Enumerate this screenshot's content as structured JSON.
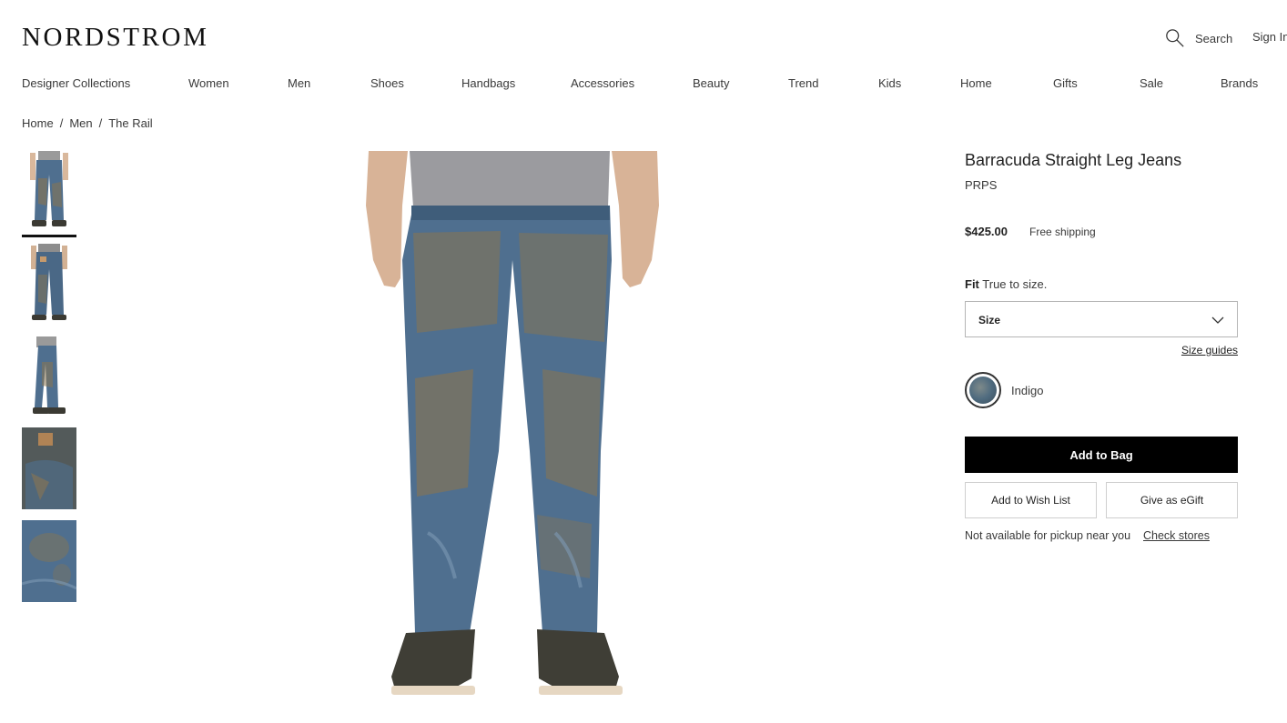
{
  "header": {
    "logo": "NORDSTROM",
    "search_label": "Search",
    "signin_label": "Sign In"
  },
  "nav": {
    "items": [
      "Designer Collections",
      "Women",
      "Men",
      "Shoes",
      "Handbags",
      "Accessories",
      "Beauty",
      "Trend",
      "Kids",
      "Home",
      "Gifts",
      "Sale",
      "Brands"
    ]
  },
  "breadcrumb": {
    "items": [
      "Home",
      "Men",
      "The Rail"
    ],
    "separator": "/"
  },
  "gallery": {
    "thumbnails": [
      {
        "name": "thumb-front"
      },
      {
        "name": "thumb-back"
      },
      {
        "name": "thumb-side"
      },
      {
        "name": "thumb-pocket-detail"
      },
      {
        "name": "thumb-fabric-detail"
      }
    ],
    "selected_index": 0
  },
  "product": {
    "title": "Barracuda Straight Leg Jeans",
    "brand": "PRPS",
    "price": "$425.00",
    "shipping": "Free shipping",
    "fit_label": "Fit",
    "fit_value": "True to size.",
    "size_label": "Size",
    "size_guides": "Size guides",
    "color_name": "Indigo",
    "add_to_bag": "Add to Bag",
    "add_to_wishlist": "Add to Wish List",
    "give_egift": "Give as eGift",
    "pickup_text": "Not available for pickup near you",
    "check_stores": "Check stores"
  },
  "colors": {
    "primary_button": "#000000",
    "text": "#393939",
    "denim": "#4f6f8f",
    "mud": "#8a7550"
  }
}
